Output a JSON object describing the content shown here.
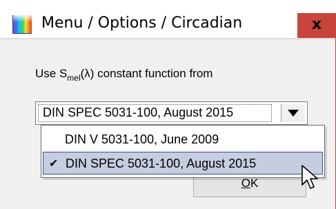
{
  "window": {
    "title": "Menu / Options / Circadian",
    "close_label": "x",
    "icon": "spectrum-app-icon"
  },
  "form": {
    "label_prefix": "Use S",
    "label_sub": "mel",
    "label_suffix": "(λ)  constant function from",
    "combo_value": "DIN SPEC 5031-100, August 2015",
    "combo_arrow_icon": "chevron-down-icon"
  },
  "dropdown": {
    "options": [
      {
        "label": "DIN V 5031-100, June 2009",
        "selected": false
      },
      {
        "label": "DIN SPEC 5031-100, August 2015",
        "selected": true
      }
    ],
    "check_icon": "checkmark-icon"
  },
  "buttons": {
    "ok_label_mnemonic": "O",
    "ok_label_rest": "K"
  },
  "colors": {
    "close_bg": "#c9443b",
    "selection_bg": "#c5cde0",
    "selection_border": "#3a4e8a"
  }
}
